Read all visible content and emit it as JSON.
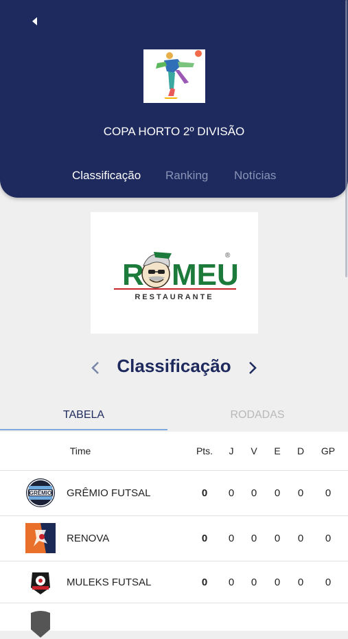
{
  "header": {
    "league_name": "COPA HORTO 2º DIVISÃO",
    "tabs": [
      {
        "label": "Classificação",
        "active": true
      },
      {
        "label": "Ranking",
        "active": false
      },
      {
        "label": "Notícias",
        "active": false
      }
    ]
  },
  "banner": {
    "brand": "ROMEU",
    "subtitle": "RESTAURANTE",
    "registered": "®"
  },
  "section": {
    "title": "Classificação"
  },
  "sub_tabs": [
    {
      "label": "TABELA",
      "active": true
    },
    {
      "label": "RODADAS",
      "active": false
    }
  ],
  "table": {
    "columns": [
      "Time",
      "Pts.",
      "J",
      "V",
      "E",
      "D",
      "GP"
    ],
    "rows": [
      {
        "team": "GRÊMIO FUTSAL",
        "logo": "gremio-logo",
        "pts": "0",
        "j": "0",
        "v": "0",
        "e": "0",
        "d": "0",
        "gp": "0"
      },
      {
        "team": "RENOVA",
        "logo": "renova-logo",
        "pts": "0",
        "j": "0",
        "v": "0",
        "e": "0",
        "d": "0",
        "gp": "0"
      },
      {
        "team": "MULEKS FUTSAL",
        "logo": "muleks-logo",
        "pts": "0",
        "j": "0",
        "v": "0",
        "e": "0",
        "d": "0",
        "gp": "0"
      }
    ]
  },
  "colors": {
    "header_bg": "#1e2a5e",
    "accent_underline": "#7da9dc",
    "brand_green": "#1c7a3a",
    "brand_red": "#c8232c"
  }
}
